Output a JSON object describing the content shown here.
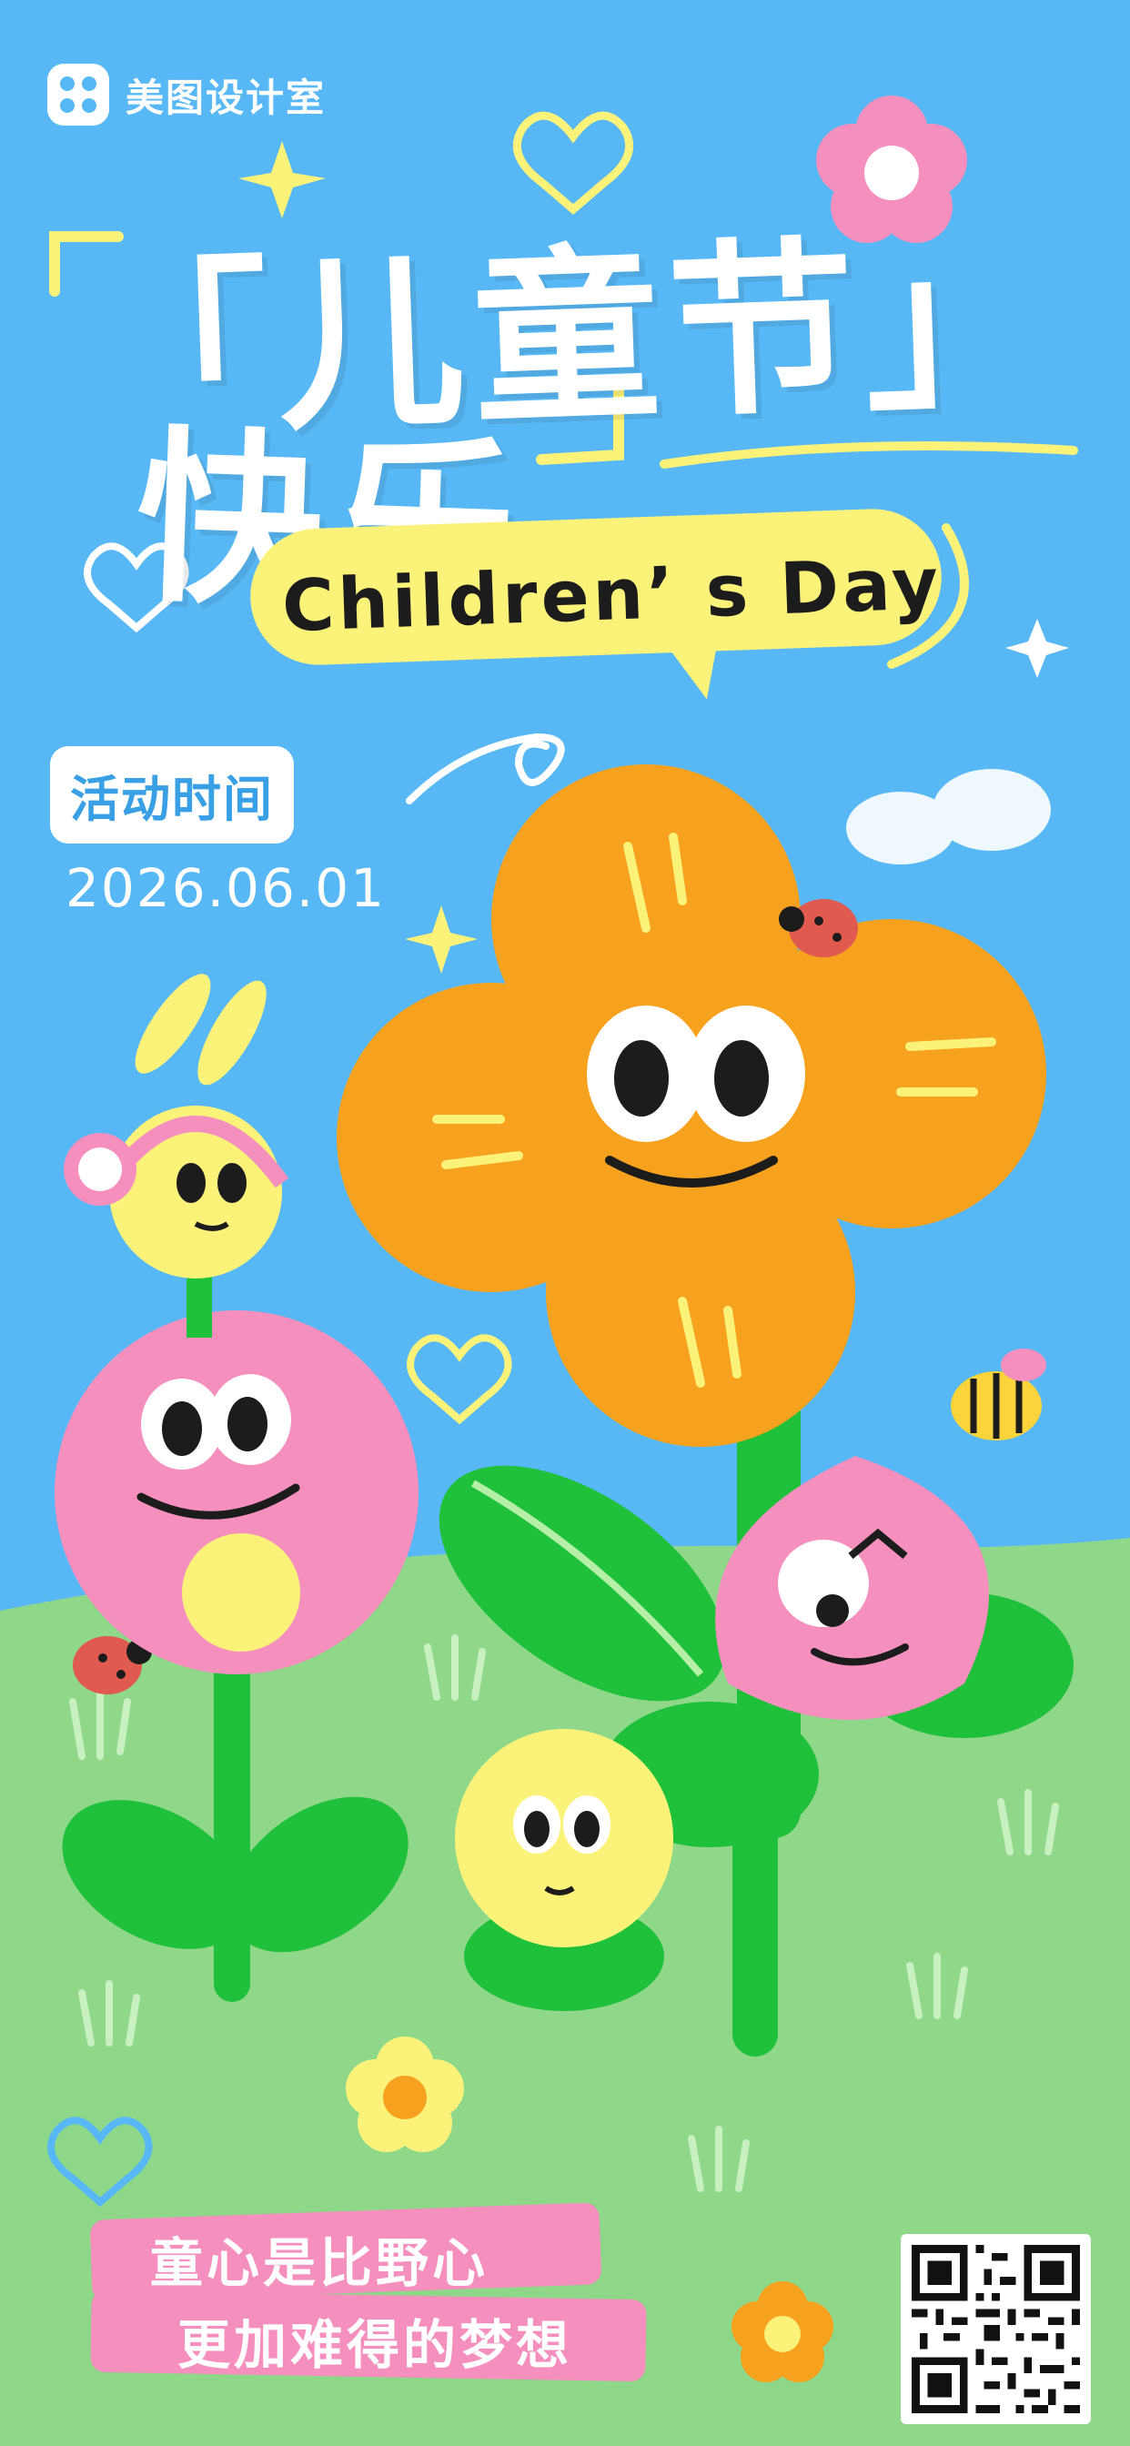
{
  "brand": {
    "logo_text": "美图设计室"
  },
  "title": {
    "part1": "「儿童节」",
    "part2": "快乐"
  },
  "subtitle": "Children’ s Day",
  "event": {
    "label": "活动时间",
    "date": "2026.06.01"
  },
  "slogan": {
    "line1": "童心是比野心",
    "line2": "更加难得的梦想"
  },
  "colors": {
    "sky": "#57b8f5",
    "grass": "#8fd88a",
    "orange": "#f6a21e",
    "pink": "#f48fbe",
    "yellow": "#fbf27a",
    "green": "#1fc03a"
  },
  "icons": [
    "heart-icon",
    "star-icon",
    "flower-icon",
    "ladybug-icon",
    "bee-icon",
    "qr-code-icon",
    "cloud-icon"
  ]
}
